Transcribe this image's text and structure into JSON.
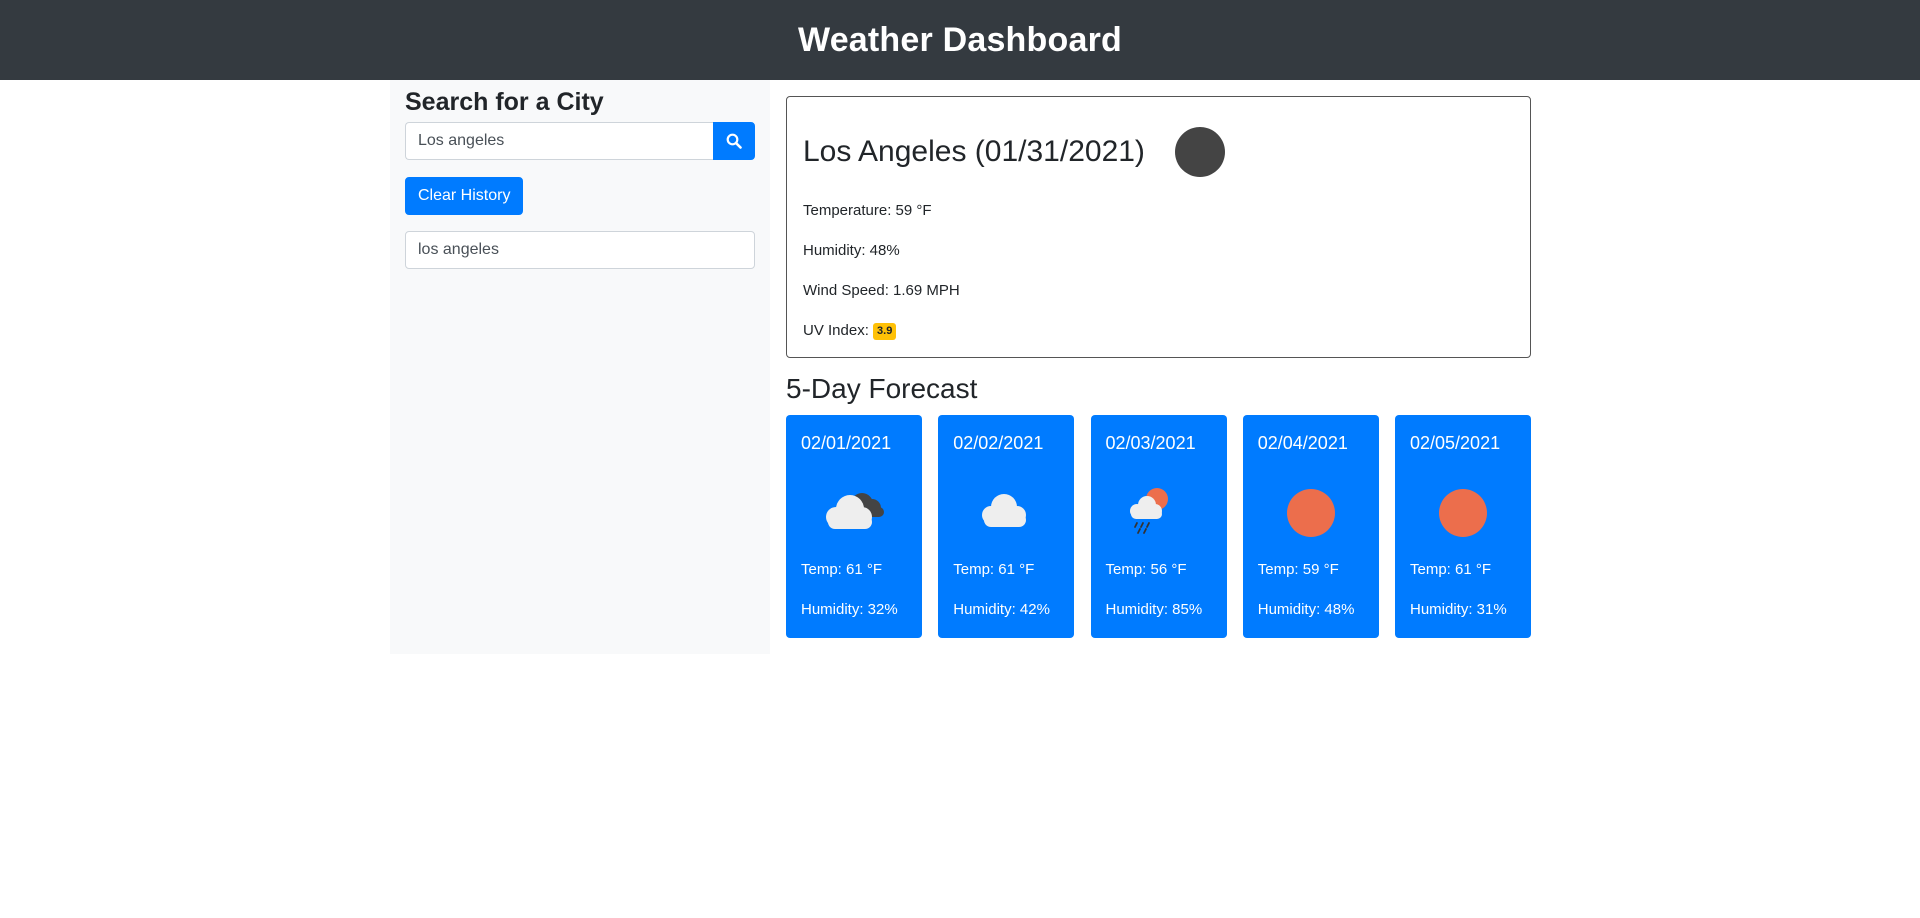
{
  "header": {
    "title": "Weather Dashboard"
  },
  "sidebar": {
    "heading": "Search for a City",
    "search_value": "Los angeles",
    "search_icon": "search-icon",
    "clear_label": "Clear History",
    "history": [
      "los angeles"
    ]
  },
  "current": {
    "title": "Los Angeles (01/31/2021)",
    "icon": "clear-night-icon",
    "temperature": "Temperature: 59 °F",
    "humidity": "Humidity: 48%",
    "wind": "Wind Speed: 1.69 MPH",
    "uv_label": "UV Index:",
    "uv_value": "3.9",
    "uv_color": "#ffc107"
  },
  "forecast": {
    "heading": "5-Day Forecast",
    "card_color": "#007bff",
    "days": [
      {
        "date": "02/01/2021",
        "icon": "broken-clouds-icon",
        "temp": "Temp: 61 °F",
        "humidity": "Humidity: 32%"
      },
      {
        "date": "02/02/2021",
        "icon": "cloud-icon",
        "temp": "Temp: 61 °F",
        "humidity": "Humidity: 42%"
      },
      {
        "date": "02/03/2021",
        "icon": "rain-sun-icon",
        "temp": "Temp: 56 °F",
        "humidity": "Humidity: 85%"
      },
      {
        "date": "02/04/2021",
        "icon": "sun-icon",
        "temp": "Temp: 59 °F",
        "humidity": "Humidity: 48%"
      },
      {
        "date": "02/05/2021",
        "icon": "sun-icon",
        "temp": "Temp: 61 °F",
        "humidity": "Humidity: 31%"
      }
    ]
  }
}
